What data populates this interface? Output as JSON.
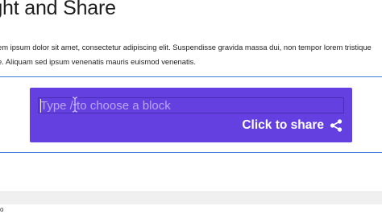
{
  "page": {
    "title": "ight and Share"
  },
  "paragraph": {
    "line1": "em ipsum dolor sit amet, consectetur adipiscing elit. Suspendisse gravida massa dui, non tempor lorem tristique",
    "line2": "e. Aliquam sed ipsum venenatis mauris euismod venenatis."
  },
  "block": {
    "input_placeholder": "Type / to choose a block",
    "share_label": "Click to share",
    "share_icon": "share-icon",
    "background_color": "#6540e0"
  },
  "footer": {
    "corner_text": "o"
  }
}
